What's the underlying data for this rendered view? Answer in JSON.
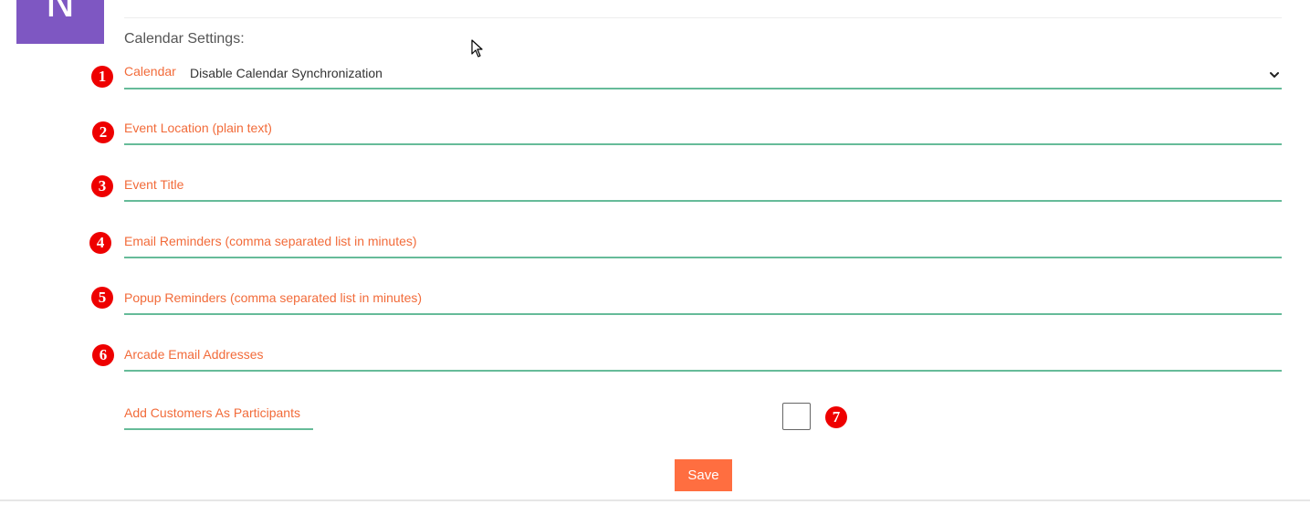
{
  "avatar": {
    "letter": "N"
  },
  "section": {
    "title": "Calendar Settings:"
  },
  "markers": [
    "1",
    "2",
    "3",
    "4",
    "5",
    "6",
    "7"
  ],
  "fields": {
    "calendar": {
      "label": "Calendar",
      "value": "Disable Calendar Synchronization"
    },
    "event_location": {
      "label": "Event Location (plain text)"
    },
    "event_title": {
      "label": "Event Title"
    },
    "email_reminders": {
      "label": "Email Reminders (comma separated list in minutes)"
    },
    "popup_reminders": {
      "label": "Popup Reminders (comma separated list in minutes)"
    },
    "arcade_emails": {
      "label": "Arcade Email Addresses"
    },
    "add_customers": {
      "label": "Add Customers As Participants",
      "checked": false
    }
  },
  "actions": {
    "save_label": "Save"
  },
  "colors": {
    "accent": "#f26b3a",
    "underline": "#66bb99",
    "marker": "#ee0000",
    "button": "#ff6e40",
    "avatar": "#7e57c2"
  }
}
